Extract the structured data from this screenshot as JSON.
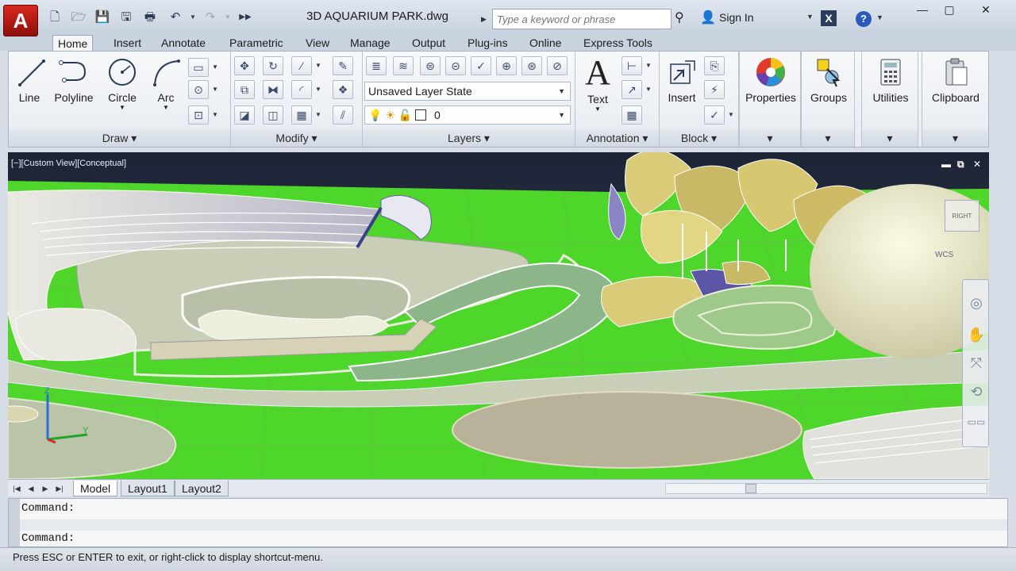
{
  "titlebar": {
    "logo": "A",
    "qat": [
      "new-icon",
      "open-icon",
      "save-icon",
      "save-as-icon",
      "plot-icon",
      "undo-icon",
      "redo-icon",
      "more-icon"
    ],
    "document_title": "3D AQUARIUM PARK.dwg",
    "search_placeholder": "Type a keyword or phrase",
    "sign_in": "Sign In",
    "help": "?",
    "exchange": "X",
    "win_min": "—",
    "win_max": "▢",
    "win_close": "✕"
  },
  "tabs": [
    "Home",
    "Insert",
    "Annotate",
    "Parametric",
    "View",
    "Manage",
    "Output",
    "Plug-ins",
    "Online",
    "Express Tools"
  ],
  "panels": {
    "draw": {
      "title": "Draw",
      "tools": [
        "Line",
        "Polyline",
        "Circle",
        "Arc"
      ]
    },
    "modify": {
      "title": "Modify"
    },
    "layers": {
      "title": "Layers",
      "layer_state": "Unsaved Layer State",
      "current_layer": "0"
    },
    "annotation": {
      "title": "Annotation",
      "tool": "Text"
    },
    "block": {
      "title": "Block",
      "tool": "Insert"
    },
    "properties": {
      "tool": "Properties"
    },
    "groups": {
      "tool": "Groups"
    },
    "utilities": {
      "tool": "Utilities"
    },
    "clipboard": {
      "tool": "Clipboard"
    }
  },
  "viewport": {
    "label": "[−][Custom View][Conceptual]",
    "viewcube_face": "RIGHT",
    "wcs": "WCS",
    "colors": {
      "grass": "#4fd62a",
      "path": "#c9cfb6",
      "structure": "#eeeedd",
      "accent": "#6a5ea8"
    }
  },
  "layouts": {
    "tabs": [
      "Model",
      "Layout1",
      "Layout2"
    ],
    "active": "Model"
  },
  "command": {
    "history": "Command:",
    "prompt": "Command:"
  },
  "status": {
    "message": "Press ESC or ENTER to exit, or right-click to display shortcut-menu."
  }
}
